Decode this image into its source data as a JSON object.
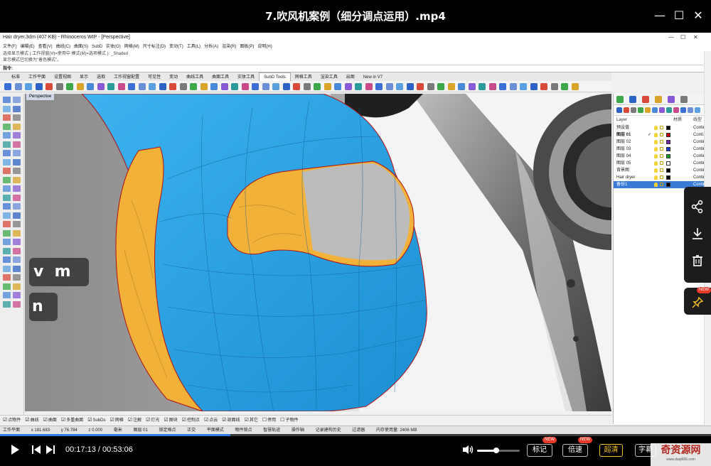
{
  "player": {
    "title": "7.吹风机案例（细分调点运用）.mp4",
    "current_time": "00:17:13",
    "total_time": "00:53:06",
    "time_display": "00:17:13 / 00:53:06",
    "progress": 0.324,
    "volume": 0.45,
    "buttons": {
      "mark": "标记",
      "speed": "倍速",
      "quality": "超清",
      "subtitle": "字幕"
    },
    "new_badge": "NEW"
  },
  "rhino": {
    "window_title": "Hair dryer.3dm (407 KB) - Rhinoceros WIP - [Perspective]",
    "menu": [
      "文件(F)",
      "编辑(E)",
      "查看(V)",
      "曲线(C)",
      "曲面(S)",
      "SubD",
      "实体(O)",
      "网格(M)",
      "尺寸标注(D)",
      "变动(T)",
      "工具(L)",
      "分析(A)",
      "渲染(R)",
      "面板(P)",
      "说明(H)"
    ],
    "command_history": [
      "选择显示模式 ( 工作视窗(V)=使用中  模式(M)=选项模式 ): _Shaded",
      "显示模式已切换为\"着色模式\"。"
    ],
    "command_prompt": "指令:",
    "tabs": [
      "标准",
      "工作平面",
      "设置视图",
      "显示",
      "选取",
      "工作视窗配置",
      "可见性",
      "变动",
      "曲线工具",
      "曲面工具",
      "实体工具",
      "SubD Tools",
      "网格工具",
      "渲染工具",
      "出图",
      "New in V7"
    ],
    "active_tab": "SubD Tools",
    "viewport_label": "Perspective",
    "layer_panel": {
      "header_layer": "Layer",
      "header_material": "材质",
      "header_linetype": "线型",
      "layers": [
        {
          "name": "预设值",
          "check": "",
          "color": "#000000",
          "linetype": "Contin..."
        },
        {
          "name": "图层 01",
          "check": "✓",
          "color": "#c00000",
          "linetype": "Conti...",
          "bold": true
        },
        {
          "name": "图层 02",
          "check": "",
          "color": "#7a1fa8",
          "linetype": "Contin..."
        },
        {
          "name": "图层 03",
          "check": "",
          "color": "#1a36d6",
          "linetype": "Contin..."
        },
        {
          "name": "图层 04",
          "check": "",
          "color": "#1e9e2a",
          "linetype": "Contin..."
        },
        {
          "name": "图层 05",
          "check": "",
          "color": "#ffffff",
          "linetype": "Contin..."
        },
        {
          "name": "背景图",
          "check": "",
          "color": "#000000",
          "linetype": "Contin..."
        },
        {
          "name": "Hair dryer",
          "check": "",
          "color": "#000000",
          "linetype": "Contin..."
        },
        {
          "name": "备份1",
          "check": "",
          "color": "#000000",
          "linetype": "Contin...",
          "selected": true
        }
      ]
    },
    "osnap": [
      {
        "label": "点物件",
        "on": true
      },
      {
        "label": "曲线",
        "on": true
      },
      {
        "label": "曲面",
        "on": true
      },
      {
        "label": "多重曲面",
        "on": true
      },
      {
        "label": "SubDs",
        "on": true
      },
      {
        "label": "网格",
        "on": true
      },
      {
        "label": "注解",
        "on": true
      },
      {
        "label": "灯光",
        "on": true
      },
      {
        "label": "图块",
        "on": true
      },
      {
        "label": "控制点",
        "on": true
      },
      {
        "label": "点云",
        "on": true
      },
      {
        "label": "剖面线",
        "on": true
      },
      {
        "label": "其它",
        "on": true
      },
      {
        "label": "停用",
        "on": false
      },
      {
        "label": "子物件",
        "on": false
      }
    ],
    "status": {
      "cplane": "工作平面",
      "x": "x 181.683",
      "y": "y 76.784",
      "z": "z 0.000",
      "unit": "毫米",
      "layer": "图层 01",
      "grid_snap": "锁定格点",
      "ortho": "正交",
      "planar": "平面模式",
      "osnap": "物件锁点",
      "smarttrack": "智慧轨迹",
      "gumball": "操作轴",
      "record": "记录建构历史",
      "filter": "过滤器",
      "memory": "内存使用量: 2406 MB"
    }
  },
  "overlay_keys": {
    "row1": "v  m",
    "row2": "n"
  },
  "watermark": {
    "text": "奇资源网",
    "sub": "www.daqi666.com"
  },
  "colors": {
    "subd_blue": "#2aa3e4",
    "subd_inner": "#f2b23a",
    "accent": "#2f7be5"
  }
}
